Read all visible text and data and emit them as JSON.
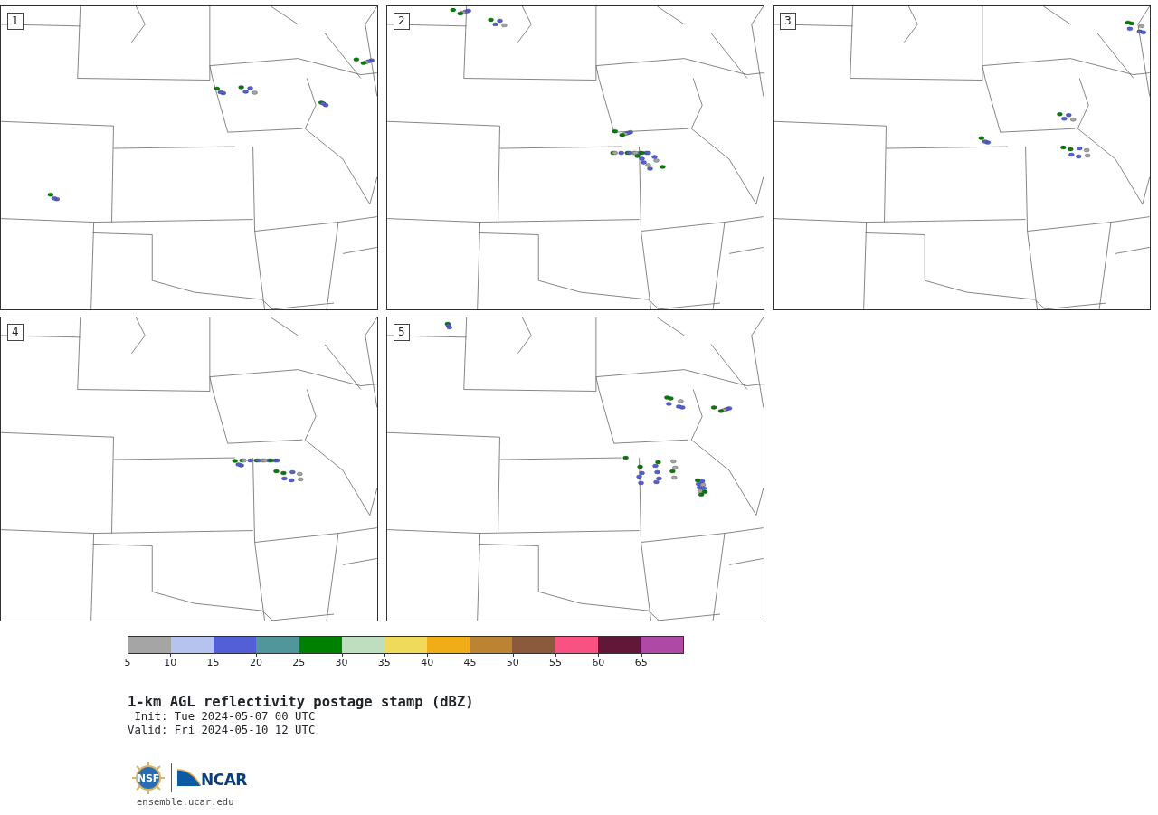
{
  "panels": [
    {
      "number": "1"
    },
    {
      "number": "2"
    },
    {
      "number": "3"
    },
    {
      "number": "4"
    },
    {
      "number": "5"
    }
  ],
  "colorbar": {
    "bins": [
      {
        "color": "#a5a5a5"
      },
      {
        "color": "#b7c3ef"
      },
      {
        "color": "#525fd6"
      },
      {
        "color": "#50969b"
      },
      {
        "color": "#008000"
      },
      {
        "color": "#bfddbf"
      },
      {
        "color": "#f0da5c"
      },
      {
        "color": "#f0ad17"
      },
      {
        "color": "#bb8332"
      },
      {
        "color": "#8b5a3c"
      },
      {
        "color": "#f75281"
      },
      {
        "color": "#611838"
      },
      {
        "color": "#ae4aa6"
      }
    ],
    "ticks": [
      "5",
      "10",
      "15",
      "20",
      "25",
      "30",
      "35",
      "40",
      "45",
      "50",
      "55",
      "60",
      "65"
    ]
  },
  "title": "1-km AGL reflectivity postage stamp (dBZ)",
  "init": " Init: Tue 2024-05-07 00 UTC",
  "valid": "Valid: Fri 2024-05-10 12 UTC",
  "logo": {
    "nsf": "NSF",
    "ncar": "NCAR"
  },
  "url": "ensemble.ucar.edu"
}
